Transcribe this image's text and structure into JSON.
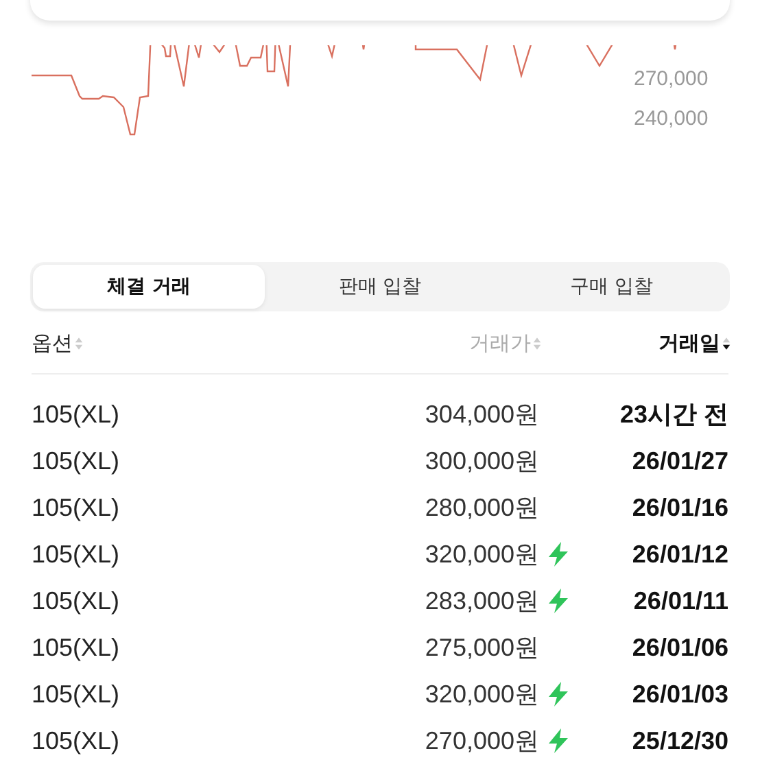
{
  "chart": {
    "y_labels": [
      "270,000",
      "240,000"
    ]
  },
  "tabs": [
    {
      "label": "체결 거래",
      "selected": true
    },
    {
      "label": "판매 입찰",
      "selected": false
    },
    {
      "label": "구매 입찰",
      "selected": false
    }
  ],
  "table": {
    "columns": [
      {
        "label": "옵션",
        "sorted": false
      },
      {
        "label": "거래가",
        "sorted": false
      },
      {
        "label": "거래일",
        "sorted": true
      }
    ],
    "rows": [
      {
        "option": "105(XL)",
        "price": "304,000원",
        "fast": false,
        "date": "23시간 전"
      },
      {
        "option": "105(XL)",
        "price": "300,000원",
        "fast": false,
        "date": "26/01/27"
      },
      {
        "option": "105(XL)",
        "price": "280,000원",
        "fast": false,
        "date": "26/01/16"
      },
      {
        "option": "105(XL)",
        "price": "320,000원",
        "fast": true,
        "date": "26/01/12"
      },
      {
        "option": "105(XL)",
        "price": "283,000원",
        "fast": true,
        "date": "26/01/11"
      },
      {
        "option": "105(XL)",
        "price": "275,000원",
        "fast": false,
        "date": "26/01/06"
      },
      {
        "option": "105(XL)",
        "price": "320,000원",
        "fast": true,
        "date": "26/01/03"
      },
      {
        "option": "105(XL)",
        "price": "270,000원",
        "fast": true,
        "date": "25/12/30"
      }
    ]
  }
}
